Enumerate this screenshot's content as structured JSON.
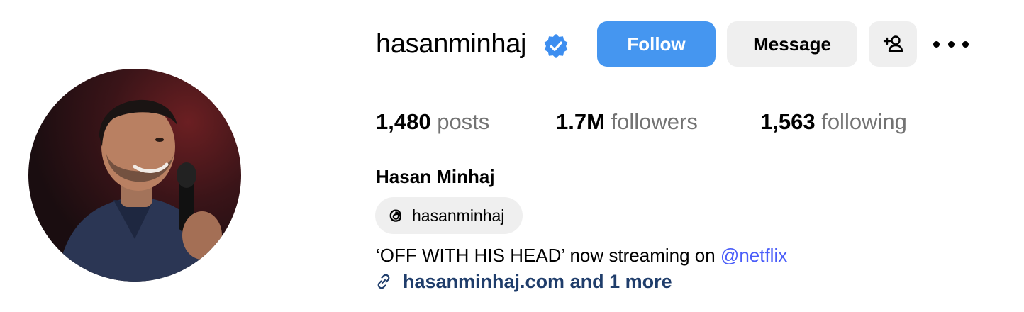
{
  "profile": {
    "username": "hasanminhaj",
    "verified": true,
    "full_name": "Hasan Minhaj",
    "avatar_icon": "profile-photo"
  },
  "actions": {
    "follow_label": "Follow",
    "message_label": "Message",
    "add_user_icon": "add-user-icon",
    "more_icon": "more-options-icon"
  },
  "stats": {
    "posts_count": "1,480",
    "posts_label": "posts",
    "followers_count": "1.7M",
    "followers_label": "followers",
    "following_count": "1,563",
    "following_label": "following"
  },
  "threads": {
    "icon": "threads-icon",
    "handle": "hasanminhaj"
  },
  "bio": {
    "text": "‘OFF WITH HIS HEAD’ now streaming on ",
    "mention": "@netflix"
  },
  "links": {
    "icon": "link-icon",
    "text": "hasanminhaj.com and 1 more"
  },
  "colors": {
    "follow_button": "#4596f0",
    "secondary_button": "#efefef",
    "mention": "#4a5df9",
    "link": "#1f3d6b",
    "stat_label": "#737373",
    "verified_badge": "#3d8ef0"
  }
}
